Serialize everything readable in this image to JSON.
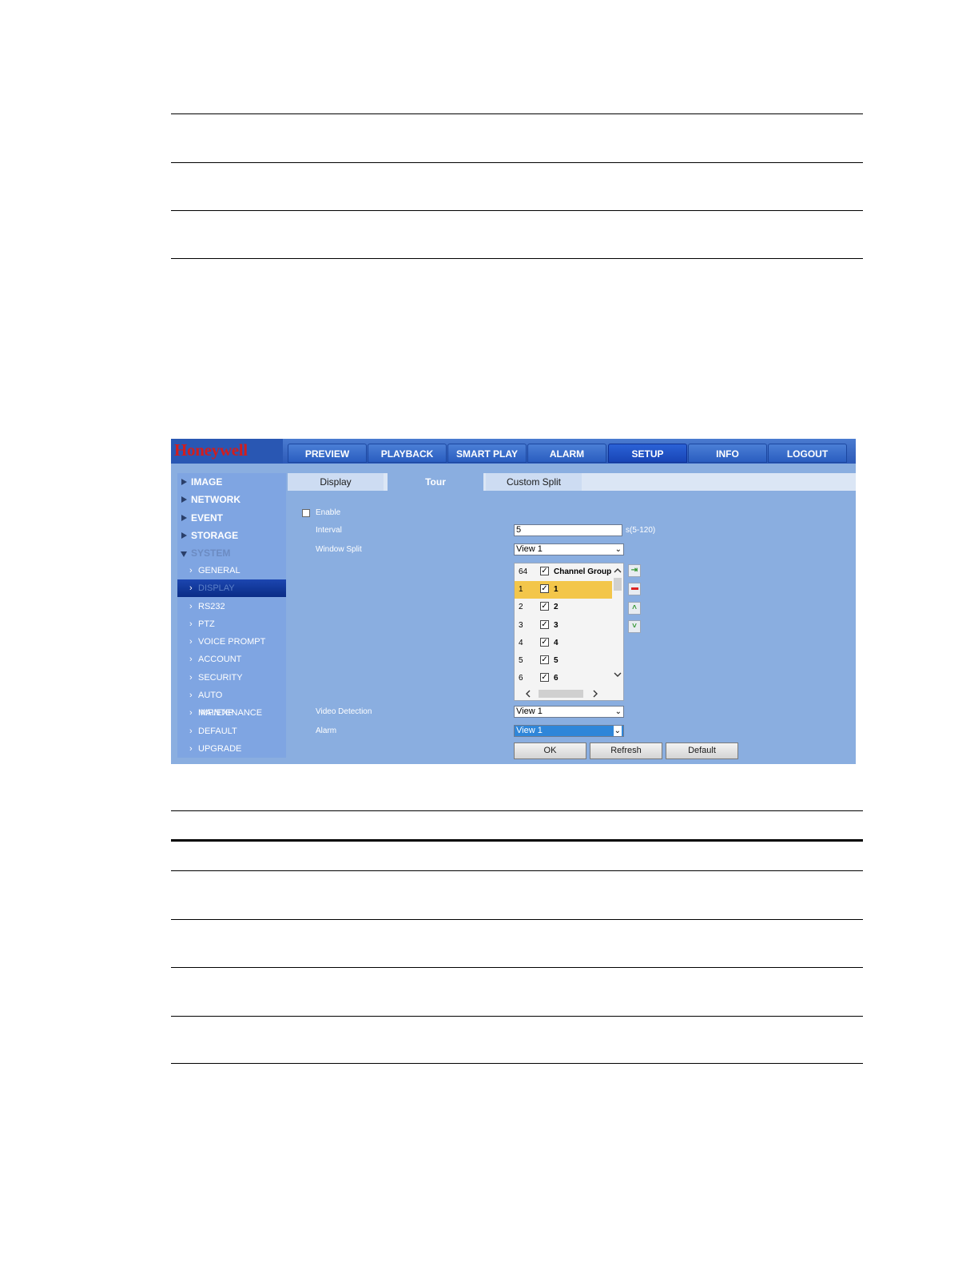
{
  "brand": "Honeywell",
  "nav": {
    "items": [
      {
        "label": "PREVIEW"
      },
      {
        "label": "PLAYBACK"
      },
      {
        "label": "SMART PLAY"
      },
      {
        "label": "ALARM"
      },
      {
        "label": "SETUP",
        "active": true
      },
      {
        "label": "INFO"
      },
      {
        "label": "LOGOUT"
      }
    ]
  },
  "sidebar": {
    "items": [
      {
        "label": "IMAGE",
        "level": "top"
      },
      {
        "label": "NETWORK",
        "level": "top"
      },
      {
        "label": "EVENT",
        "level": "top"
      },
      {
        "label": "STORAGE",
        "level": "top"
      },
      {
        "label": "SYSTEM",
        "level": "top",
        "expanded": true
      },
      {
        "label": "GENERAL",
        "level": "sub"
      },
      {
        "label": "DISPLAY",
        "level": "sub",
        "selected": true
      },
      {
        "label": "RS232",
        "level": "sub"
      },
      {
        "label": "PTZ",
        "level": "sub"
      },
      {
        "label": "VOICE PROMPT",
        "level": "sub"
      },
      {
        "label": "ACCOUNT",
        "level": "sub"
      },
      {
        "label": "SECURITY",
        "level": "sub"
      },
      {
        "label": "AUTO MAINTENANCE",
        "level": "sub"
      },
      {
        "label": "IMP/EXP",
        "level": "sub"
      },
      {
        "label": "DEFAULT",
        "level": "sub"
      },
      {
        "label": "UPGRADE",
        "level": "sub"
      }
    ]
  },
  "tabs": [
    {
      "label": "Display"
    },
    {
      "label": "Tour",
      "active": true
    },
    {
      "label": "Custom Split"
    }
  ],
  "form": {
    "enable_label": "Enable",
    "enable_checked": false,
    "interval_label": "Interval",
    "interval_value": "5",
    "interval_hint": "s(5-120)",
    "window_split_label": "Window Split",
    "window_split_value": "View 1",
    "video_detection_label": "Video Detection",
    "video_detection_value": "View 1",
    "alarm_label": "Alarm",
    "alarm_value": "View 1"
  },
  "channel_list": {
    "header_num": "64",
    "header_label": "Channel Group",
    "rows": [
      {
        "num": "1",
        "label": "1",
        "checked": true,
        "selected": true
      },
      {
        "num": "2",
        "label": "2",
        "checked": true
      },
      {
        "num": "3",
        "label": "3",
        "checked": true
      },
      {
        "num": "4",
        "label": "4",
        "checked": true
      },
      {
        "num": "5",
        "label": "5",
        "checked": true
      },
      {
        "num": "6",
        "label": "6",
        "checked": true
      }
    ]
  },
  "buttons": {
    "ok": "OK",
    "refresh": "Refresh",
    "default": "Default"
  },
  "icons": {
    "add": "add-icon",
    "delete": "delete-icon",
    "move_up": "move-up-icon",
    "move_down": "move-down-icon"
  }
}
